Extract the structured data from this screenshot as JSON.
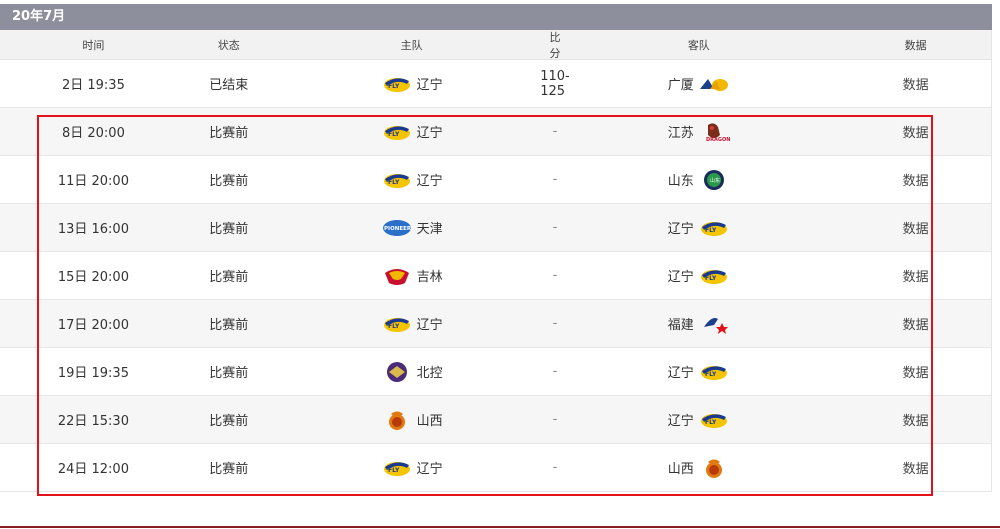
{
  "month_title": "20年7月",
  "headers": {
    "time": "时间",
    "status": "状态",
    "home": "主队",
    "score": "比分",
    "away": "客队",
    "data": "数据"
  },
  "rows": [
    {
      "time": "2日 19:35",
      "status": "已结束",
      "home": "辽宁",
      "home_logo": "liaoning-logo",
      "score": "110-125",
      "away": "广厦",
      "away_logo": "guangsha-logo",
      "data": "数据"
    },
    {
      "time": "8日 20:00",
      "status": "比赛前",
      "home": "辽宁",
      "home_logo": "liaoning-logo",
      "score": "-",
      "away": "江苏",
      "away_logo": "jiangsu-logo",
      "data": "数据"
    },
    {
      "time": "11日 20:00",
      "status": "比赛前",
      "home": "辽宁",
      "home_logo": "liaoning-logo",
      "score": "-",
      "away": "山东",
      "away_logo": "shandong-logo",
      "data": "数据"
    },
    {
      "time": "13日 16:00",
      "status": "比赛前",
      "home": "天津",
      "home_logo": "tianjin-logo",
      "score": "-",
      "away": "辽宁",
      "away_logo": "liaoning-logo",
      "data": "数据"
    },
    {
      "time": "15日 20:00",
      "status": "比赛前",
      "home": "吉林",
      "home_logo": "jilin-logo",
      "score": "-",
      "away": "辽宁",
      "away_logo": "liaoning-logo",
      "data": "数据"
    },
    {
      "time": "17日 20:00",
      "status": "比赛前",
      "home": "辽宁",
      "home_logo": "liaoning-logo",
      "score": "-",
      "away": "福建",
      "away_logo": "fujian-logo",
      "data": "数据"
    },
    {
      "time": "19日 19:35",
      "status": "比赛前",
      "home": "北控",
      "home_logo": "beikong-logo",
      "score": "-",
      "away": "辽宁",
      "away_logo": "liaoning-logo",
      "data": "数据"
    },
    {
      "time": "22日 15:30",
      "status": "比赛前",
      "home": "山西",
      "home_logo": "shanxi-logo",
      "score": "-",
      "away": "辽宁",
      "away_logo": "liaoning-logo",
      "data": "数据"
    },
    {
      "time": "24日 12:00",
      "status": "比赛前",
      "home": "辽宁",
      "home_logo": "liaoning-logo",
      "score": "-",
      "away": "山西",
      "away_logo": "shanxi-logo",
      "data": "数据"
    }
  ],
  "colors": {
    "month_bar": "#8e8f9c",
    "highlight": "#e2111b",
    "alt_row": "#f6f6f6"
  }
}
